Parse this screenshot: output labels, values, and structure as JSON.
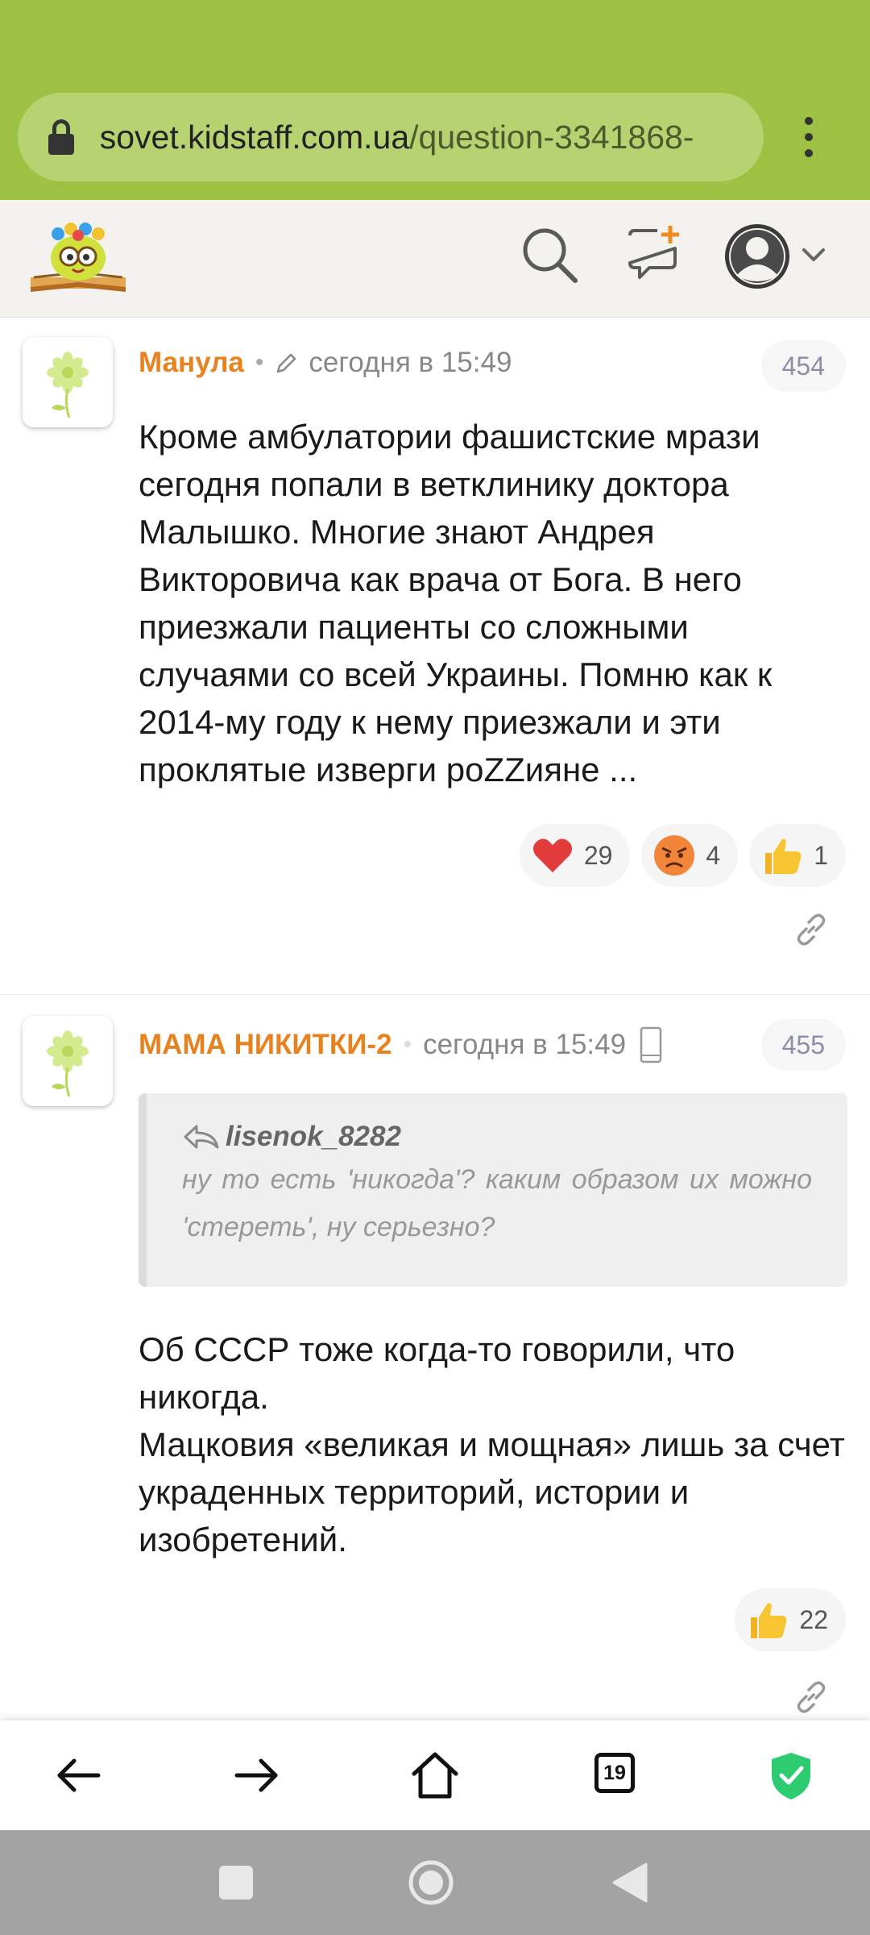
{
  "browser": {
    "url_host": "sovet.kidstaff.com.ua",
    "url_path": "/question-3341868-",
    "tab_count": "19"
  },
  "site_header": {
    "logo_icon": "kidstaff-logo",
    "icons": [
      "search-icon",
      "new-message-icon",
      "user-avatar-icon",
      "chevron-down-icon"
    ]
  },
  "comments": [
    {
      "author": "Манула",
      "time": "сегодня в 15:49",
      "number": "454",
      "text": "Кроме амбулатории фашистские мрази сегодня попали в ветклинику доктора Малышко. Многие знают Андрея Викторовича как врача от Бога. В него приезжали пациенты со сложными случаями со всей Украины. Помню как к 2014-му году к нему приезжали и эти проклятые изверги poZZияне ...",
      "reactions": [
        {
          "icon": "heart-emoji",
          "count": "29"
        },
        {
          "icon": "angry-emoji",
          "count": "4"
        },
        {
          "icon": "thumbs-up-emoji",
          "count": "1"
        }
      ]
    },
    {
      "author": "МАМА НИКИТКИ-2",
      "time": "сегодня в 15:49",
      "number": "455",
      "quote_author": "lisenok_8282",
      "quote_text": "ну то есть 'никогда'? каким образом их можно 'стереть', ну серьезно?",
      "text_lines": [
        "Об СССР тоже когда-то говорили, что никогда.",
        "Мацковия «великая и мощная» лишь за счет украденных территорий, истории и изобретений."
      ],
      "reactions": [
        {
          "icon": "thumbs-up-emoji",
          "count": "22"
        }
      ]
    }
  ],
  "colors": {
    "browser_bar": "#9dc243",
    "author": "#e8821e",
    "shield": "#2ecc71"
  }
}
